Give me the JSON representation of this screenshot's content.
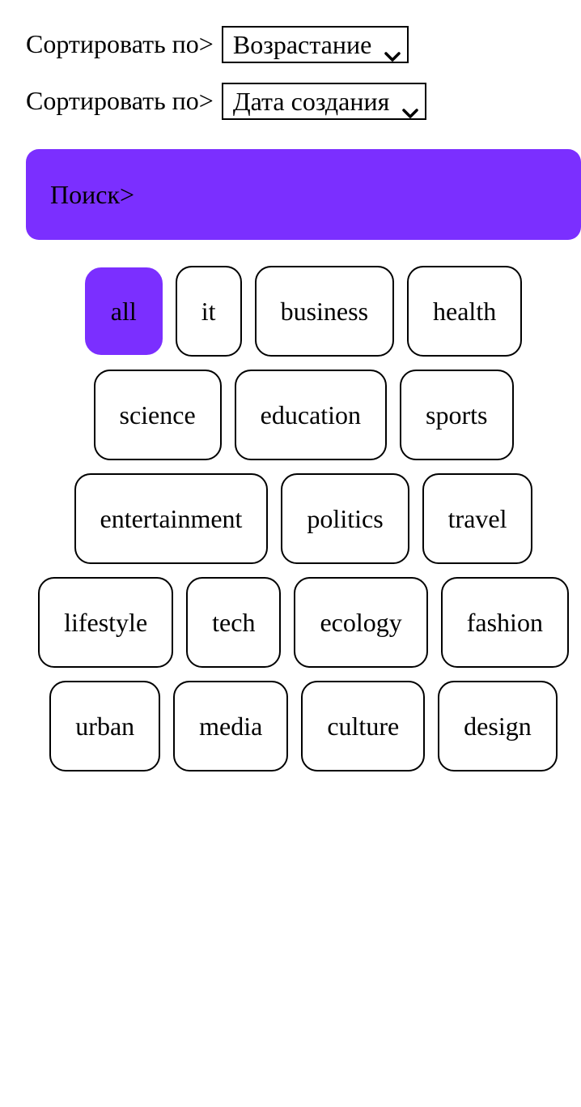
{
  "sort_order": {
    "label": "Сортировать по>",
    "selected": "Возрастание",
    "icon": "chevron-down-icon"
  },
  "sort_field": {
    "label": "Сортировать по>",
    "selected": "Дата создания",
    "icon": "chevron-down-icon"
  },
  "search": {
    "label": "Поиск>"
  },
  "colors": {
    "accent": "#7b2fff"
  },
  "tags": {
    "active": "all",
    "rows": [
      [
        "all",
        "it",
        "business",
        "health"
      ],
      [
        "science",
        "education",
        "sports"
      ],
      [
        "entertainment",
        "politics",
        "travel"
      ],
      [
        "lifestyle",
        "tech",
        "ecology",
        "fashion"
      ],
      [
        "urban",
        "media",
        "culture",
        "design"
      ]
    ]
  }
}
